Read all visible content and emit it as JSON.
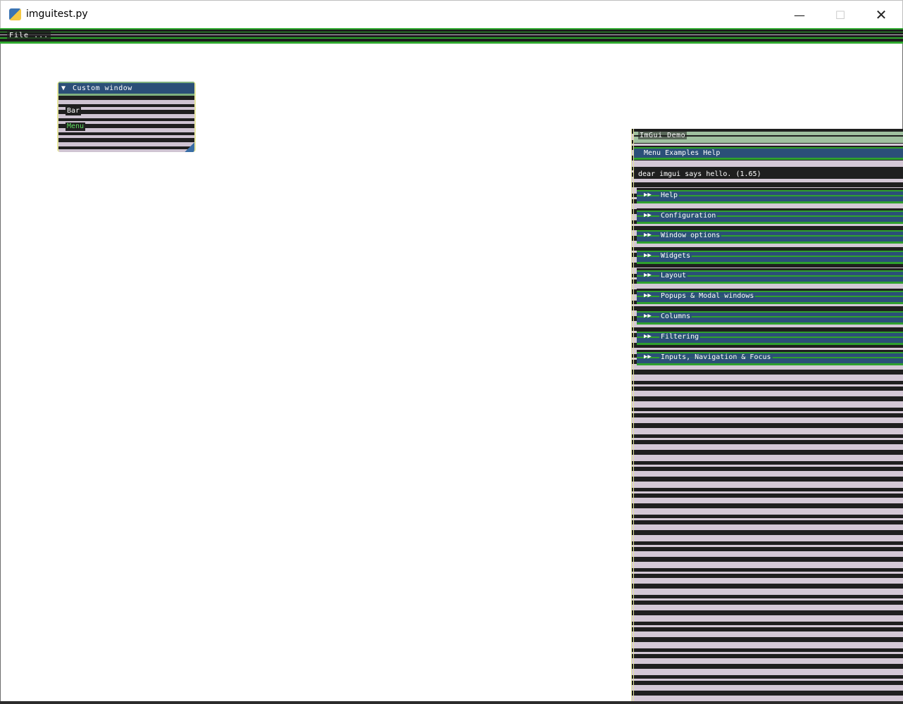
{
  "window": {
    "title": "imguitest.py",
    "minimize_glyph": "—",
    "maximize_glyph": "☐",
    "close_glyph": "✕"
  },
  "main_menu": {
    "items": [
      "File ..."
    ]
  },
  "small_window": {
    "title": "Custom window",
    "collapse_glyph": "▼",
    "lines": [
      "Bar",
      "Menu"
    ]
  },
  "demo_window": {
    "title": "ImGui Demo",
    "menu_text": "Menu  Examples  Help",
    "info_text": "dear imgui says hello. (1.65)",
    "sections": [
      "Help",
      "Configuration",
      "Window options",
      "Widgets",
      "Layout",
      "Popups & Modal windows",
      "Columns",
      "Filtering",
      "Inputs, Navigation & Focus"
    ]
  },
  "colors": {
    "title_active": "#2b4f78",
    "separator_green": "#2ea82e",
    "background": "#ffffff",
    "row_light": "#d4c8d6",
    "row_dark": "#1f1f1f"
  }
}
